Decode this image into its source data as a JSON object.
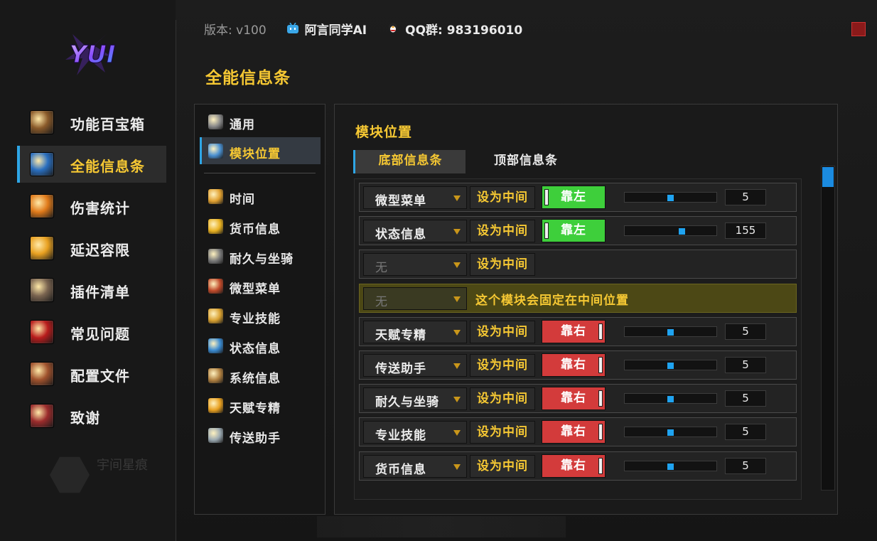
{
  "logo_text": "YUI",
  "header": {
    "version": "版本: v100",
    "author": "阿言同学AI",
    "qq_group": "QQ群: 983196010"
  },
  "main_nav": [
    {
      "label": "功能百宝箱",
      "icon": "treasure-chest-icon",
      "color": "#8a5a2a",
      "active": false
    },
    {
      "label": "全能信息条",
      "icon": "blue-rune-icon",
      "color": "#2a6fc0",
      "active": true
    },
    {
      "label": "伤害统计",
      "icon": "fire-icon",
      "color": "#e07a1a",
      "active": false
    },
    {
      "label": "延迟容限",
      "icon": "lightning-icon",
      "color": "#e8a020",
      "active": false
    },
    {
      "label": "插件清单",
      "icon": "armor-icon",
      "color": "#7a6450",
      "active": false
    },
    {
      "label": "常见问题",
      "icon": "question-mark-icon",
      "color": "#b81c1c",
      "active": false
    },
    {
      "label": "配置文件",
      "icon": "scroll-icon",
      "color": "#a0522d",
      "active": false
    },
    {
      "label": "致谢",
      "icon": "seal-icon",
      "color": "#9b2c2c",
      "active": false
    }
  ],
  "ghost_user": "宇间星痕",
  "page_title": "全能信息条",
  "sub_nav": [
    {
      "label": "通用",
      "icon": "gear-icon",
      "color": "#8a8a8a",
      "active": false
    },
    {
      "label": "模块位置",
      "icon": "move-cross-icon",
      "color": "#4a90d0",
      "active": true
    },
    {
      "label": "时间",
      "icon": "clock-icon",
      "color": "#e0a030",
      "active": false
    },
    {
      "label": "货币信息",
      "icon": "gold-coin-icon",
      "color": "#e8b020",
      "active": false
    },
    {
      "label": "耐久与坐骑",
      "icon": "anvil-icon",
      "color": "#7a7a7a",
      "active": false
    },
    {
      "label": "微型菜单",
      "icon": "gift-box-icon",
      "color": "#c04a2a",
      "active": false
    },
    {
      "label": "专业技能",
      "icon": "gems-icon",
      "color": "#d8a030",
      "active": false
    },
    {
      "label": "状态信息",
      "icon": "castle-icon",
      "color": "#3a8ad0",
      "active": false
    },
    {
      "label": "系统信息",
      "icon": "gnome-icon",
      "color": "#b08040",
      "active": false
    },
    {
      "label": "天赋专精",
      "icon": "talent-icon",
      "color": "#e8a020",
      "active": false
    },
    {
      "label": "传送助手",
      "icon": "stone-icon",
      "color": "#9aa8b0",
      "active": false
    }
  ],
  "section_title": "模块位置",
  "tabs": [
    {
      "label": "底部信息条",
      "active": true
    },
    {
      "label": "顶部信息条",
      "active": false
    }
  ],
  "center_label": "设为中间",
  "fixed_message": "这个模块会固定在中间位置",
  "rows": [
    {
      "module": "微型菜单",
      "type": "normal",
      "align": "靠左",
      "side": "left",
      "slider_pct": 50,
      "value": "5"
    },
    {
      "module": "状态信息",
      "type": "normal",
      "align": "靠左",
      "side": "left",
      "slider_pct": 63,
      "value": "155"
    },
    {
      "module": "无",
      "type": "empty"
    },
    {
      "module": "无",
      "type": "fixed"
    },
    {
      "module": "天赋专精",
      "type": "normal",
      "align": "靠右",
      "side": "right",
      "slider_pct": 50,
      "value": "5"
    },
    {
      "module": "传送助手",
      "type": "normal",
      "align": "靠右",
      "side": "right",
      "slider_pct": 50,
      "value": "5"
    },
    {
      "module": "耐久与坐骑",
      "type": "normal",
      "align": "靠右",
      "side": "right",
      "slider_pct": 50,
      "value": "5"
    },
    {
      "module": "专业技能",
      "type": "normal",
      "align": "靠右",
      "side": "right",
      "slider_pct": 50,
      "value": "5"
    },
    {
      "module": "货币信息",
      "type": "normal",
      "align": "靠右",
      "side": "right",
      "slider_pct": 50,
      "value": "5"
    }
  ],
  "colors": {
    "accent_gold": "#f6c833",
    "accent_blue": "#2ea6e6",
    "toggle_left": "#3ecf3b",
    "toggle_right": "#d33b3b",
    "close_red": "#8b1a1a"
  }
}
